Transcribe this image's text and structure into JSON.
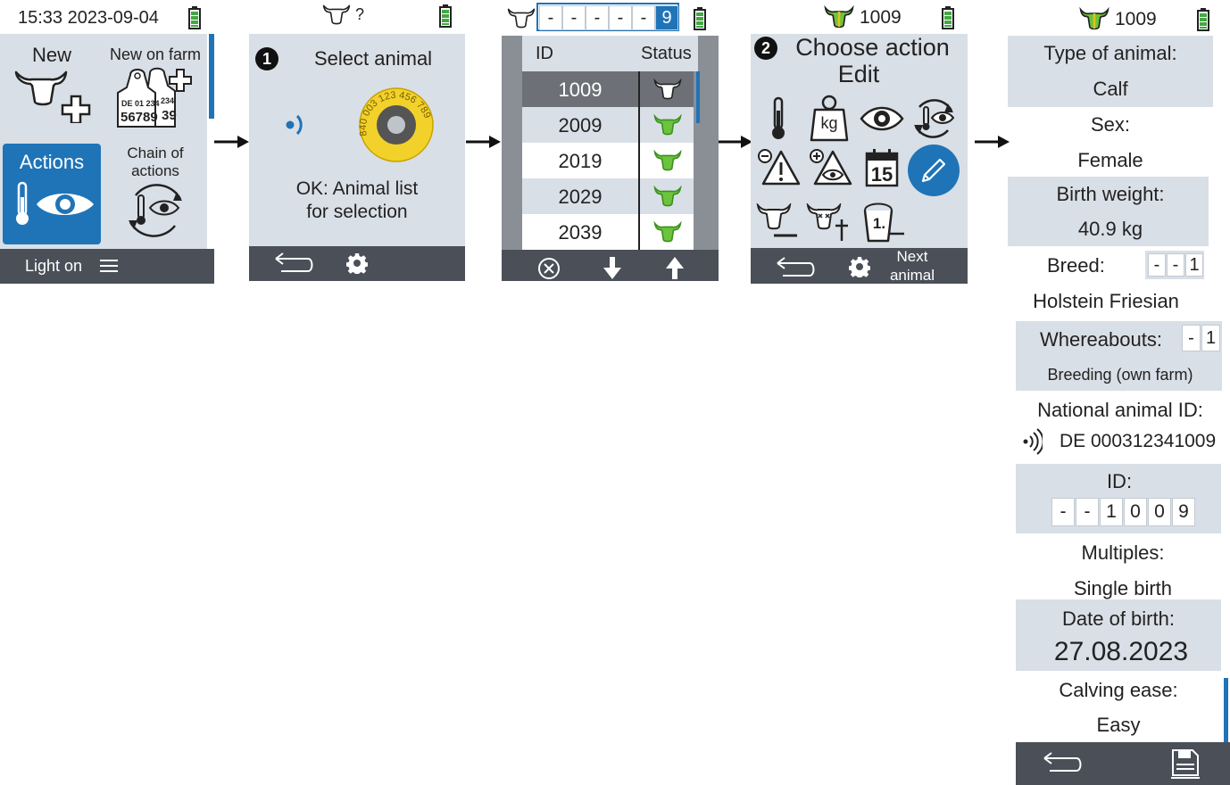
{
  "colors": {
    "panel": "#d9dfe6",
    "bar": "#4a4f58",
    "accent": "#1f74b8",
    "green": "#6cc33c",
    "battery": "#43a843"
  },
  "screen1": {
    "status": "15:33 2023-09-04",
    "new_label": "New",
    "new_on_farm_label": "New on farm",
    "ear_tag_line1": "DE 01 234",
    "ear_tag_line2": "56789",
    "ear_tag_back1": "234",
    "ear_tag_back2": "39",
    "actions_label": "Actions",
    "chain_line1": "Chain of",
    "chain_line2": "actions",
    "bottom_label": "Light on"
  },
  "screen2": {
    "status": "?",
    "step": "1",
    "title": "Select animal",
    "tag_text": "840 003 123 456 789",
    "line1": "OK: Animal list",
    "line2": "for selection"
  },
  "screen3": {
    "id_digits": [
      "-",
      "-",
      "-",
      "-",
      "-",
      "9"
    ],
    "col_id": "ID",
    "col_status": "Status",
    "rows": [
      {
        "id": "1009",
        "selected": true
      },
      {
        "id": "2009",
        "selected": false
      },
      {
        "id": "2019",
        "selected": false
      },
      {
        "id": "2029",
        "selected": false
      },
      {
        "id": "2039",
        "selected": false
      }
    ]
  },
  "screen4": {
    "status": "1009",
    "step": "2",
    "title_line1": "Choose action",
    "title_line2": "Edit",
    "kg_label": "kg",
    "calendar_label": "15",
    "bucket_label": "1.",
    "next_line1": "Next",
    "next_line2": "animal"
  },
  "screen5": {
    "status": "1009",
    "type_label": "Type of animal:",
    "type_value": "Calf",
    "sex_label": "Sex:",
    "sex_value": "Female",
    "weight_label": "Birth weight:",
    "weight_value": "40.9 kg",
    "breed_label": "Breed:",
    "breed_digits": [
      "-",
      "-",
      "1"
    ],
    "breed_value": "Holstein Friesian",
    "where_label": "Whereabouts:",
    "where_digits": [
      "-",
      "1"
    ],
    "where_value": "Breeding (own farm)",
    "nat_label": "National animal ID:",
    "nat_value": "DE 000312341009",
    "id_label": "ID:",
    "id_digits": [
      "-",
      "-",
      "1",
      "0",
      "0",
      "9"
    ],
    "mult_label": "Multiples:",
    "mult_value": "Single birth",
    "dob_label": "Date of birth:",
    "dob_value": "27.08.2023",
    "ease_label": "Calving ease:",
    "ease_value": "Easy"
  }
}
